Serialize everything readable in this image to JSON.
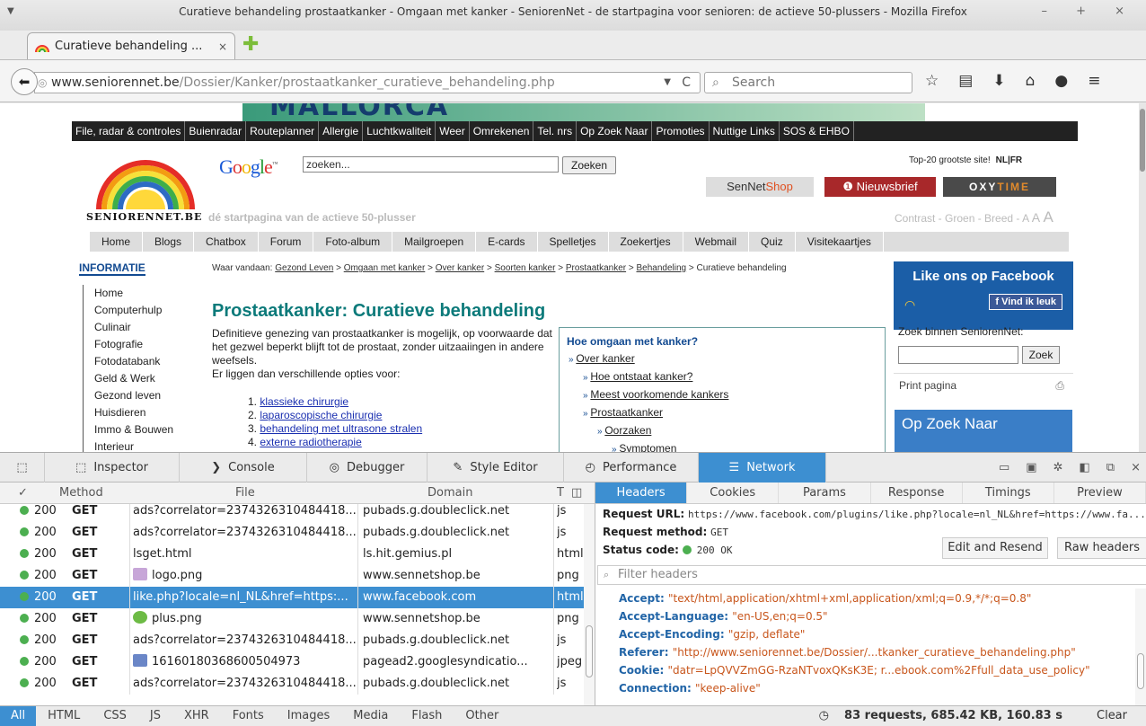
{
  "window": {
    "title": "Curatieve behandeling prostaatkanker - Omgaan met kanker - SeniorenNet - de startpagina voor senioren: de actieve 50-plussers - Mozilla Firefox",
    "controls": "– + ×"
  },
  "tab": {
    "title": "Curatieve behandeling ...",
    "close": "×"
  },
  "urlbar": {
    "host": "www.seniorennet.be",
    "path": "/Dossier/Kanker/prostaatkanker_curatieve_behandeling.php"
  },
  "search": {
    "placeholder": "Search"
  },
  "site": {
    "banner": "MALLORCA",
    "topnav": [
      "File, radar & controles",
      "Buienradar",
      "Routeplanner",
      "Allergie",
      "Luchtkwaliteit",
      "Weer",
      "Omrekenen",
      "Tel. nrs",
      "Op Zoek Naar",
      "Promoties",
      "Nuttige Links",
      "SOS & EHBO"
    ],
    "google_logo": "Google",
    "google_tm": "™",
    "google_query": "zoeken...",
    "google_button": "Zoeken",
    "top20": "Top-20 grootste site!",
    "lang": "NL|FR",
    "sennetshop_a": "SenNet",
    "sennetshop_b": "Shop",
    "nieuwsbrief": "Nieuwsbrief",
    "oxytime_a": "OXY",
    "oxytime_b": "TIME",
    "logo_text": "SENIORENNET.BE",
    "tagline": "dé startpagina van de actieve 50-plusser",
    "contrast": "Contrast - Groen - Breed - ",
    "contrast_a1": "A",
    "contrast_a2": "A",
    "contrast_a3": "A",
    "mainnav": [
      "Home",
      "Blogs",
      "Chatbox",
      "Forum",
      "Foto-album",
      "Mailgroepen",
      "E-cards",
      "Spelletjes",
      "Zoekertjes",
      "Webmail",
      "Quiz",
      "Visitekaartjes"
    ],
    "informatie": "INFORMATIE",
    "leftnav": [
      "Home",
      "Computerhulp",
      "Culinair",
      "Fotografie",
      "Fotodatabank",
      "Geld & Werk",
      "Gezond leven",
      "Huisdieren",
      "Immo & Bouwen",
      "Interieur"
    ],
    "crumbs_prefix": "Waar vandaan: ",
    "crumbs": [
      "Gezond Leven",
      "Omgaan met kanker",
      "Over kanker",
      "Soorten kanker",
      "Prostaatkanker",
      "Behandeling"
    ],
    "crumbs_sep": " > ",
    "crumbs_tail": " > Curatieve behandeling",
    "title": "Prostaatkanker: Curatieve behandeling",
    "intro": "Definitieve genezing van prostaatkanker is mogelijk, op voorwaarde dat het gezwel beperkt blijft tot de prostaat, zonder uitzaaiingen in andere weefsels.",
    "intro2": "Er liggen dan verschillende opties voor:",
    "treatments": [
      "1. ",
      "klassieke chirurgie",
      "2. ",
      "laparoscopische chirurgie",
      "3. ",
      "behandeling met ultrasone stralen",
      "4. ",
      "externe radiotherapie"
    ],
    "kanker_title": "Hoe omgaan met kanker?",
    "kanker_links": [
      "Over kanker",
      "Hoe ontstaat kanker?",
      "Meest voorkomende kankers",
      "Prostaatkanker",
      "Oorzaken",
      "Symptomen"
    ],
    "fb_title": "Like ons op Facebook",
    "fb_like": "Vind ik leuk",
    "zoek_label": "Zoek binnen SeniorenNet:",
    "zoek_button": "Zoek",
    "print": "Print pagina",
    "opzoek": "Op Zoek Naar"
  },
  "devtools": {
    "tabs": [
      "Inspector",
      "Console",
      "Debugger",
      "Style Editor",
      "Performance",
      "Network"
    ],
    "active_tab": "Network",
    "columns": {
      "check": "✓",
      "method": "Method",
      "file": "File",
      "domain": "Domain",
      "type": "T"
    },
    "requests": [
      {
        "status": "200",
        "method": "GET",
        "file": "ads?correlator=2374326310484418...",
        "domain": "pubads.g.doubleclick.net",
        "type": "js"
      },
      {
        "status": "200",
        "method": "GET",
        "file": "ads?correlator=2374326310484418...",
        "domain": "pubads.g.doubleclick.net",
        "type": "js"
      },
      {
        "status": "200",
        "method": "GET",
        "file": "lsget.html",
        "domain": "ls.hit.gemius.pl",
        "type": "html"
      },
      {
        "status": "200",
        "method": "GET",
        "file": "logo.png",
        "domain": "www.sennetshop.be",
        "type": "png"
      },
      {
        "status": "200",
        "method": "GET",
        "file": "like.php?locale=nl_NL&href=https:...",
        "domain": "www.facebook.com",
        "type": "html"
      },
      {
        "status": "200",
        "method": "GET",
        "file": "plus.png",
        "domain": "www.sennetshop.be",
        "type": "png"
      },
      {
        "status": "200",
        "method": "GET",
        "file": "ads?correlator=2374326310484418...",
        "domain": "pubads.g.doubleclick.net",
        "type": "js"
      },
      {
        "status": "200",
        "method": "GET",
        "file": "16160180368600504973",
        "domain": "pagead2.googlesyndicatio...",
        "type": "jpeg"
      },
      {
        "status": "200",
        "method": "GET",
        "file": "ads?correlator=2374326310484418...",
        "domain": "pubads.g.doubleclick.net",
        "type": "js"
      }
    ],
    "detail_tabs": [
      "Headers",
      "Cookies",
      "Params",
      "Response",
      "Timings",
      "Preview"
    ],
    "request_url_label": "Request URL:",
    "request_url": "https://www.facebook.com/plugins/like.php?locale=nl_NL&href=https://www.fa...",
    "request_method_label": "Request method:",
    "request_method": "GET",
    "status_label": "Status code:",
    "status": "200 OK",
    "edit_resend": "Edit and Resend",
    "raw_headers": "Raw headers",
    "filter_placeholder": "Filter headers",
    "headers": [
      {
        "k": "Accept",
        "v": "\"text/html,application/xhtml+xml,application/xml;q=0.9,*/*;q=0.8\""
      },
      {
        "k": "Accept-Language",
        "v": "\"en-US,en;q=0.5\""
      },
      {
        "k": "Accept-Encoding",
        "v": "\"gzip, deflate\""
      },
      {
        "k": "Referer",
        "v": "\"http://www.seniorennet.be/Dossier/...tkanker_curatieve_behandeling.php\""
      },
      {
        "k": "Cookie",
        "v": "\"datr=LpQVVZmGG-RzaNTvoxQKsK3E; r...ebook.com%2Ffull_data_use_policy\""
      },
      {
        "k": "Connection",
        "v": "\"keep-alive\""
      }
    ],
    "filters": [
      "All",
      "HTML",
      "CSS",
      "JS",
      "XHR",
      "Fonts",
      "Images",
      "Media",
      "Flash",
      "Other"
    ],
    "summary": "83 requests, 685.42 KB, 160.83 s",
    "clear": "Clear"
  },
  "colors": {
    "accent": "#3d8fd1",
    "status_ok": "#4caf50",
    "header_key": "#2265a7",
    "header_value": "#c8561c"
  }
}
